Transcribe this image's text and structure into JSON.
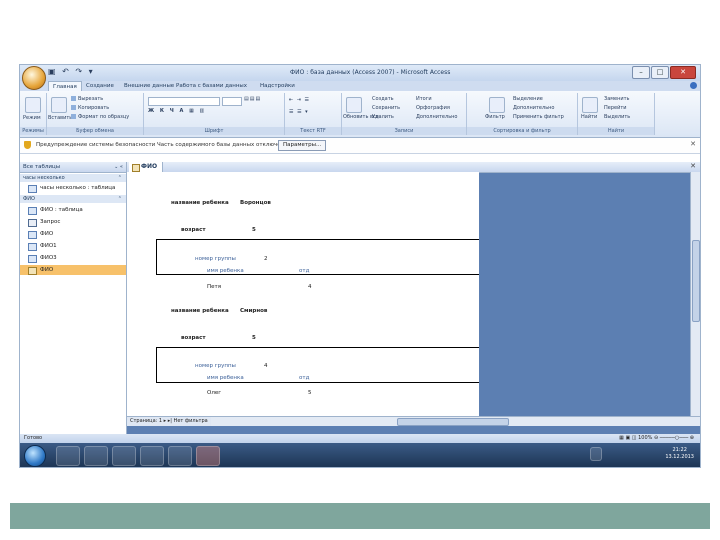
{
  "window": {
    "title": "ФИО : база данных (Access 2007) - Microsoft Access",
    "buttons": [
      "–",
      "□",
      "✕"
    ]
  },
  "ribbon_tabs": [
    "Главная",
    "Создание",
    "Внешние данные",
    "Работа с базами данных",
    "Надстройки"
  ],
  "ribbon": {
    "groups": [
      "Режимы",
      "Буфер обмена",
      "Шрифт",
      "Текст RTF",
      "Записи",
      "Сортировка и фильтр",
      "Найти"
    ],
    "view_label": "Режим",
    "clipboard": {
      "paste": "Вставить",
      "cut": "Вырезать",
      "copy": "Копировать",
      "format": "Формат по образцу"
    },
    "records": {
      "refresh": "Обновить все",
      "new": "Создать",
      "save": "Сохранить",
      "delete": "Удалить",
      "totals": "Итоги",
      "spelling": "Орфография",
      "more": "Дополнительно"
    },
    "sort": {
      "filter": "Фильтр",
      "selection": "Выделение",
      "advanced": "Дополнительно",
      "toggle": "Применить фильтр"
    },
    "find": {
      "find": "Найти",
      "replace": "Заменить",
      "goto": "Перейти",
      "select": "Выделить"
    }
  },
  "message_bar": {
    "text": "Предупреждение системы безопасности  Часть содержимого базы данных отключена",
    "button": "Параметры..."
  },
  "nav_pane": {
    "header": "Все таблицы",
    "groups": [
      {
        "name": "часы несколько",
        "items": [
          {
            "label": "часы несколько : таблица",
            "icon": "table-icon"
          }
        ]
      },
      {
        "name": "ФИО",
        "items": [
          {
            "label": "ФИО : таблица",
            "icon": "table-icon"
          },
          {
            "label": "Запрос",
            "icon": "query-icon"
          },
          {
            "label": "ФИО",
            "icon": "form-icon"
          },
          {
            "label": "ФИО1",
            "icon": "form-icon"
          },
          {
            "label": "ФИО3",
            "icon": "form-icon"
          },
          {
            "label": "ФИО",
            "icon": "report-icon"
          }
        ]
      }
    ]
  },
  "document_tab": "ФИО",
  "report": {
    "records": [
      {
        "name_label": "название ребенка",
        "name_value": "Воронцов",
        "age_label": "возраст",
        "age_value": "5",
        "group_label": "номер группы",
        "group_value": "2",
        "child_label": "имя ребенка",
        "child_col2": "отд",
        "child_name": "Петя",
        "child_value": "4"
      },
      {
        "name_label": "название ребенка",
        "name_value": "Смирнов",
        "age_label": "возраст",
        "age_value": "5",
        "group_label": "номер группы",
        "group_value": "4",
        "child_label": "имя ребенка",
        "child_col2": "отд",
        "child_name": "Олег",
        "child_value": "5"
      }
    ]
  },
  "record_nav": "Страница: 1 ▸ ▸| Нет фильтра",
  "status": {
    "left": "Готово",
    "zoom": "100%"
  },
  "clock": {
    "time": "21:22",
    "date": "13.12.2013"
  }
}
